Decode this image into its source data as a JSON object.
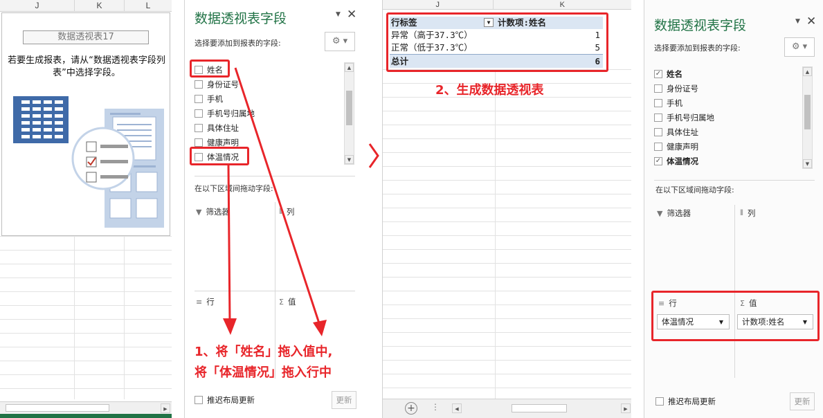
{
  "left_sheet": {
    "columns": [
      "J",
      "K",
      "L"
    ],
    "pivot_title": "数据透视表17",
    "pivot_message": "若要生成报表，请从“数据透视表字段列表”中选择字段。"
  },
  "pane_left": {
    "title": "数据透视表字段",
    "subtitle": "选择要添加到报表的字段:",
    "fields": [
      {
        "label": "姓名",
        "checked": false
      },
      {
        "label": "身份证号",
        "checked": false
      },
      {
        "label": "手机",
        "checked": false
      },
      {
        "label": "手机号归属地",
        "checked": false
      },
      {
        "label": "具体住址",
        "checked": false
      },
      {
        "label": "健康声明",
        "checked": false
      },
      {
        "label": "体温情况",
        "checked": false
      }
    ],
    "drag_label": "在以下区域间拖动字段:",
    "areas": {
      "filter": "筛选器",
      "columns": "列",
      "rows": "行",
      "values": "值"
    },
    "defer_label": "推迟布局更新",
    "update_label": "更新",
    "annotation_line1": "1、将「姓名」拖入值中,",
    "annotation_line2": "将「体温情况」拖入行中"
  },
  "middle_sheet": {
    "columns": [
      "J",
      "K"
    ],
    "pivot": {
      "header_rows": "行标签",
      "header_values": "计数项:姓名",
      "rows": [
        {
          "label": "异常（高于37.3℃）",
          "value": "1"
        },
        {
          "label": "正常（低于37.3℃）",
          "value": "5"
        }
      ],
      "total_label": "总计",
      "total_value": "6"
    },
    "annotation": "2、生成数据透视表"
  },
  "pane_right": {
    "title": "数据透视表字段",
    "subtitle": "选择要添加到报表的字段:",
    "fields": [
      {
        "label": "姓名",
        "checked": true
      },
      {
        "label": "身份证号",
        "checked": false
      },
      {
        "label": "手机",
        "checked": false
      },
      {
        "label": "手机号归属地",
        "checked": false
      },
      {
        "label": "具体住址",
        "checked": false
      },
      {
        "label": "健康声明",
        "checked": false
      },
      {
        "label": "体温情况",
        "checked": true
      }
    ],
    "drag_label": "在以下区域间拖动字段:",
    "areas": {
      "filter": "筛选器",
      "columns": "列",
      "rows": "行",
      "values": "值"
    },
    "row_field": "体温情况",
    "value_field": "计数项:姓名",
    "defer_label": "推迟布局更新",
    "update_label": "更新"
  },
  "colors": {
    "accent_green": "#217346",
    "annotation_red": "#e8252a",
    "pivot_header": "#dbe6f3"
  }
}
